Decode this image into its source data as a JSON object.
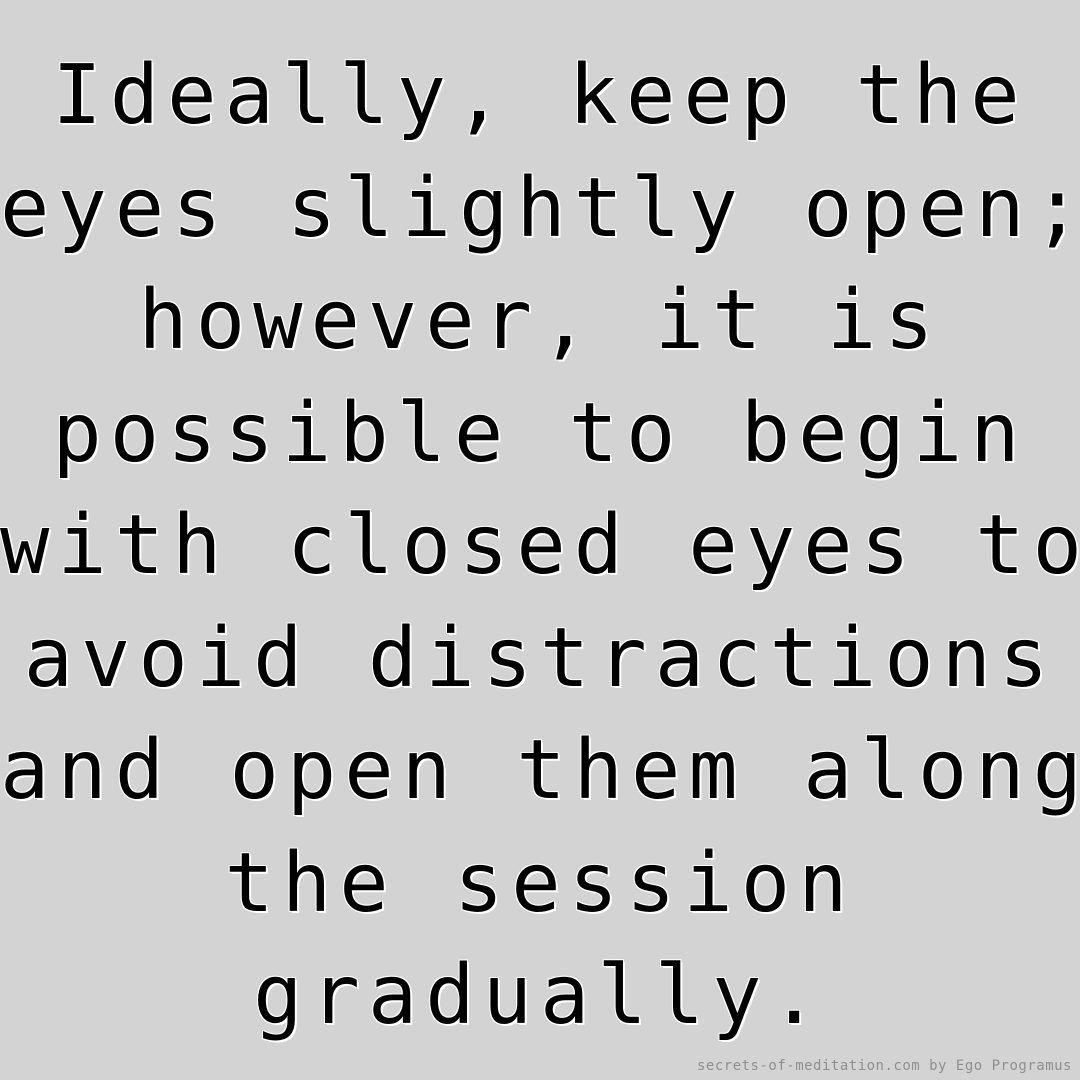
{
  "quote": {
    "lines": [
      "Ideally, keep the",
      "eyes slightly open;",
      "however, it is",
      "possible to begin",
      "with closed eyes to",
      "avoid distractions",
      "and open them along",
      "the session",
      "gradually."
    ]
  },
  "credit": "secrets-of-meditation.com by Ego Programus",
  "colors": {
    "background": "#d3d3d3",
    "text": "#000000",
    "text_outline": "#ffffff",
    "credit_text": "#8f8f8f"
  }
}
